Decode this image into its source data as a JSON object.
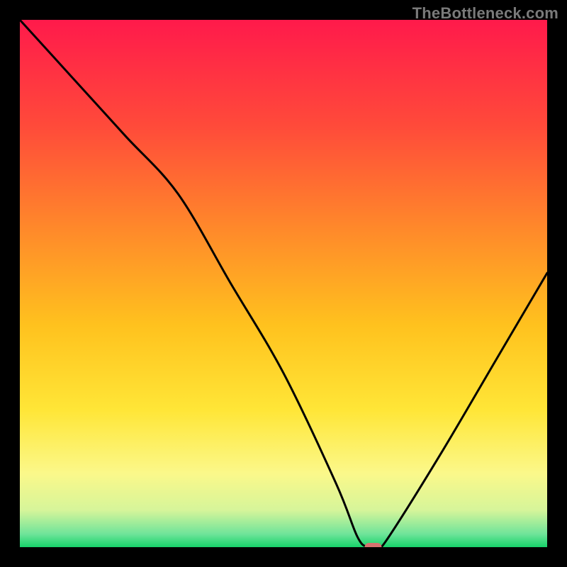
{
  "watermark": {
    "text": "TheBottleneck.com"
  },
  "chart_data": {
    "type": "line",
    "title": "",
    "xlabel": "",
    "ylabel": "",
    "xlim": [
      0,
      100
    ],
    "ylim": [
      0,
      100
    ],
    "grid": false,
    "legend": false,
    "series": [
      {
        "name": "bottleneck-curve",
        "x": [
          0,
          10,
          20,
          30,
          40,
          50,
          60,
          64,
          66,
          68,
          70,
          80,
          90,
          100
        ],
        "values": [
          100,
          89,
          78,
          67,
          50,
          33,
          12,
          2,
          0,
          0,
          2,
          18,
          35,
          52
        ]
      }
    ],
    "marker": {
      "name": "operating-point",
      "x": 67,
      "y": 0,
      "color": "#d6726f"
    },
    "background_gradient": {
      "stops": [
        {
          "offset": 0.0,
          "color": "#ff1a4b"
        },
        {
          "offset": 0.2,
          "color": "#ff4a3a"
        },
        {
          "offset": 0.4,
          "color": "#ff8a2a"
        },
        {
          "offset": 0.58,
          "color": "#ffc21e"
        },
        {
          "offset": 0.74,
          "color": "#ffe637"
        },
        {
          "offset": 0.86,
          "color": "#fbf88a"
        },
        {
          "offset": 0.93,
          "color": "#d6f59a"
        },
        {
          "offset": 0.975,
          "color": "#6fe49a"
        },
        {
          "offset": 1.0,
          "color": "#17d36a"
        }
      ]
    }
  }
}
